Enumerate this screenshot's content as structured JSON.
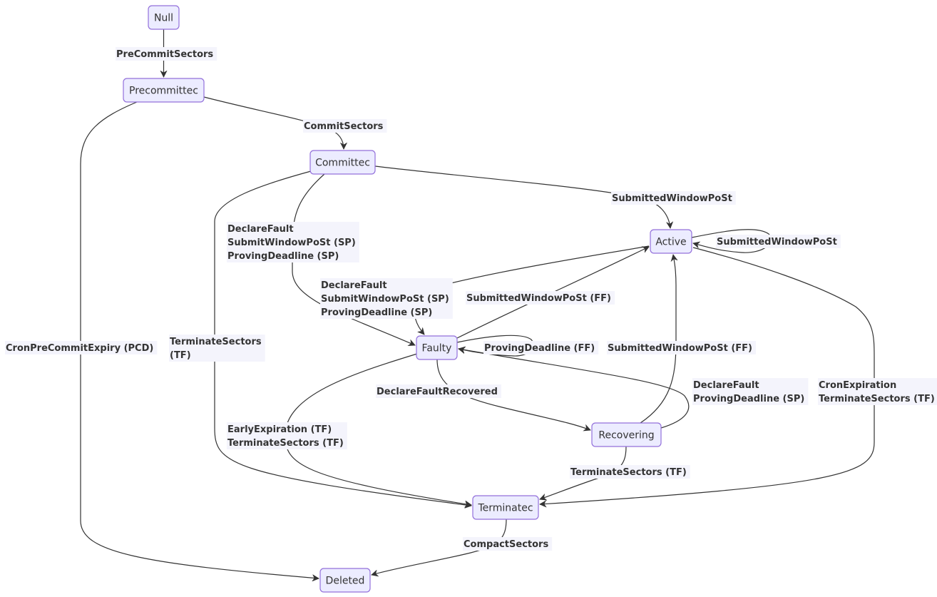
{
  "diagram": {
    "type": "state-diagram",
    "colors": {
      "node_fill": "#ececff",
      "node_stroke": "#9370db",
      "edge": "#333333",
      "text": "#333333",
      "label_bg": "#f4f4fc"
    },
    "nodes": [
      {
        "id": "null",
        "label": "Null"
      },
      {
        "id": "precommitted",
        "label": "Precommittec"
      },
      {
        "id": "committed",
        "label": "Committec"
      },
      {
        "id": "active",
        "label": "Active"
      },
      {
        "id": "faulty",
        "label": "Faulty"
      },
      {
        "id": "recovering",
        "label": "Recovering"
      },
      {
        "id": "terminated",
        "label": "Terminatec"
      },
      {
        "id": "deleted",
        "label": "Deleted"
      }
    ],
    "edges": [
      {
        "id": "e1",
        "from": "null",
        "to": "precommitted",
        "label": [
          "PreCommitSectors"
        ]
      },
      {
        "id": "e2",
        "from": "precommitted",
        "to": "committed",
        "label": [
          "CommitSectors"
        ]
      },
      {
        "id": "e3",
        "from": "precommitted",
        "to": "deleted",
        "label": [
          "CronPreCommitExpiry (PCD)"
        ]
      },
      {
        "id": "e4",
        "from": "committed",
        "to": "active",
        "label": [
          "SubmittedWindowPoSt"
        ]
      },
      {
        "id": "e5",
        "from": "committed",
        "to": "faulty",
        "label": [
          "DeclareFault",
          "SubmitWindowPoSt (SP)",
          "ProvingDeadline (SP)"
        ]
      },
      {
        "id": "e6",
        "from": "committed",
        "to": "terminated",
        "label": [
          "TerminateSectors",
          "(TF)"
        ]
      },
      {
        "id": "e7",
        "from": "active",
        "to": "active",
        "label": [
          "SubmittedWindowPoSt"
        ]
      },
      {
        "id": "e8",
        "from": "active",
        "to": "faulty",
        "label": [
          "DeclareFault",
          "SubmitWindowPoSt (SP)",
          "ProvingDeadline (SP)"
        ]
      },
      {
        "id": "e9",
        "from": "active",
        "to": "terminated",
        "label": [
          "CronExpiration",
          "TerminateSectors (TF)"
        ]
      },
      {
        "id": "e10",
        "from": "faulty",
        "to": "active",
        "label": [
          "SubmittedWindowPoSt (FF)"
        ]
      },
      {
        "id": "e11",
        "from": "faulty",
        "to": "faulty",
        "label": [
          "ProvingDeadline (FF)"
        ]
      },
      {
        "id": "e12",
        "from": "faulty",
        "to": "recovering",
        "label": [
          "DeclareFaultRecovered"
        ]
      },
      {
        "id": "e13",
        "from": "faulty",
        "to": "terminated",
        "label": [
          "EarlyExpiration (TF)",
          "TerminateSectors (TF)"
        ]
      },
      {
        "id": "e14",
        "from": "recovering",
        "to": "active",
        "label": [
          "SubmittedWindowPoSt (FF)"
        ]
      },
      {
        "id": "e15",
        "from": "recovering",
        "to": "faulty",
        "label": [
          "DeclareFault",
          "ProvingDeadline (SP)"
        ]
      },
      {
        "id": "e16",
        "from": "recovering",
        "to": "terminated",
        "label": [
          "TerminateSectors (TF)"
        ]
      },
      {
        "id": "e17",
        "from": "terminated",
        "to": "deleted",
        "label": [
          "CompactSectors"
        ]
      }
    ]
  }
}
